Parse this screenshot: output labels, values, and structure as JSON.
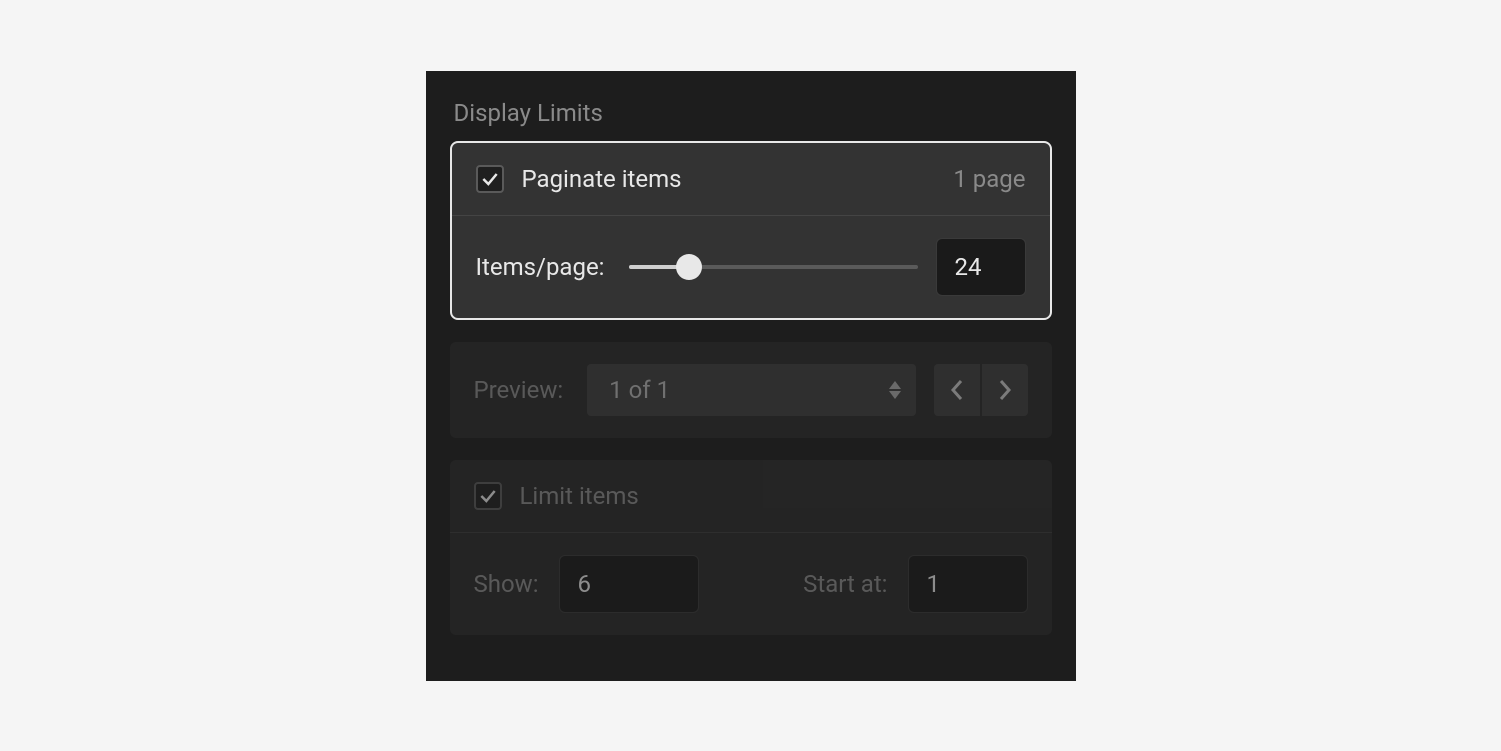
{
  "section_title": "Display Limits",
  "paginate": {
    "checkbox_label": "Paginate items",
    "page_count_text": "1 page",
    "items_per_page_label": "Items/page:",
    "items_per_page_value": "24",
    "slider_percent": 21
  },
  "preview": {
    "label": "Preview:",
    "selected": "1 of 1"
  },
  "limit": {
    "checkbox_label": "Limit items",
    "show_label": "Show:",
    "show_value": "6",
    "start_label": "Start at:",
    "start_value": "1"
  }
}
